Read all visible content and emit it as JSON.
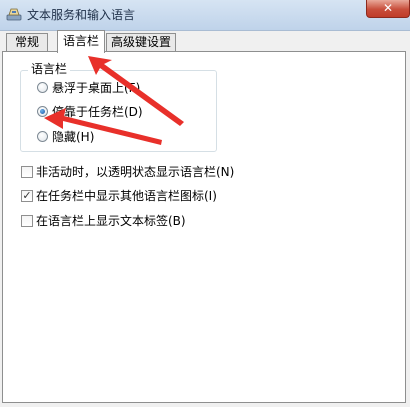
{
  "window": {
    "title": "文本服务和输入语言",
    "close_glyph": "✕"
  },
  "tabs": [
    {
      "label": "常规",
      "active": false
    },
    {
      "label": "语言栏",
      "active": true
    },
    {
      "label": "高级键设置",
      "active": false
    }
  ],
  "language_bar_group": {
    "label": "语言栏",
    "options": [
      {
        "label": "悬浮于桌面上(F)",
        "selected": false
      },
      {
        "label": "停靠于任务栏(D)",
        "selected": true
      },
      {
        "label": "隐藏(H)",
        "selected": false
      }
    ]
  },
  "checkboxes": [
    {
      "label": "非活动时，以透明状态显示语言栏(N)",
      "checked": false
    },
    {
      "label": "在任务栏中显示其他语言栏图标(I)",
      "checked": true
    },
    {
      "label": "在语言栏上显示文本标签(B)",
      "checked": false
    }
  ],
  "check_glyph": "✓",
  "annotation_color": "#e8302a"
}
